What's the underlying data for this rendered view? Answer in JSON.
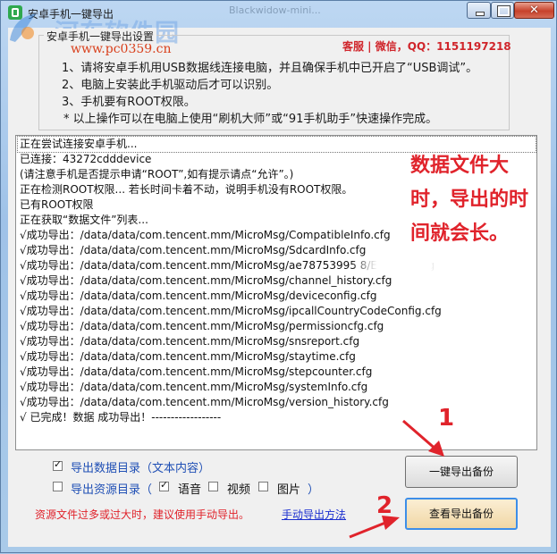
{
  "window": {
    "title": "安卓手机一键导出",
    "background_tab_text": "Blackwidow-mini...",
    "close_glyph": "✕"
  },
  "watermark": {
    "site": "河东软件园",
    "url": "www.pc0359.cn"
  },
  "settings_group": {
    "legend": "安卓手机一键导出设置",
    "contact": "客服 | 微信，QQ：1151197218",
    "instructions": [
      "1、请将安卓手机用USB数据线连接电脑，并且确保手机中已开启了“USB调试”。",
      "2、电脑上安装此手机驱动后才可以识别。",
      "3、手机要有ROOT权限。",
      "* 以上操作可以在电脑上使用“刷机大师”或“91手机助手”快速操作完成。"
    ]
  },
  "log": {
    "lines": [
      "正在尝试连接安卓手机...",
      "已连接：43272cdddevice",
      "(请注意手机是否提示申请“ROOT”,如有提示请点“允许”。)",
      "正在检测ROOT权限...      若长时间卡着不动，说明手机没有ROOT权限。",
      "已有ROOT权限",
      "正在获取“数据文件”列表...",
      "√成功导出：/data/data/com.tencent.mm/MicroMsg/CompatibleInfo.cfg",
      "√成功导出：/data/data/com.tencent.mm/MicroMsg/SdcardInfo.cfg",
      "√成功导出：/data/data/com.tencent.mm/MicroMsg/ae78753995                          8/EnMicroMsg",
      "√成功导出：/data/data/com.tencent.mm/MicroMsg/channel_history.cfg",
      "√成功导出：/data/data/com.tencent.mm/MicroMsg/deviceconfig.cfg",
      "√成功导出：/data/data/com.tencent.mm/MicroMsg/ipcallCountryCodeConfig.cfg",
      "√成功导出：/data/data/com.tencent.mm/MicroMsg/permissioncfg.cfg",
      "√成功导出：/data/data/com.tencent.mm/MicroMsg/snsreport.cfg",
      "√成功导出：/data/data/com.tencent.mm/MicroMsg/staytime.cfg",
      "√成功导出：/data/data/com.tencent.mm/MicroMsg/stepcounter.cfg",
      "√成功导出：/data/data/com.tencent.mm/MicroMsg/systemInfo.cfg",
      "√成功导出：/data/data/com.tencent.mm/MicroMsg/version_history.cfg",
      "√ 已完成！数据 成功导出！------------------"
    ]
  },
  "annotation": {
    "note_lines": [
      "数据文件大",
      "时，导出的时",
      "间就会长。"
    ],
    "num1": "1",
    "num2": "2",
    "color": "#e0232b"
  },
  "options": {
    "export_data_dir": {
      "label": "导出数据目录（文本内容）",
      "checked": true
    },
    "export_resource_dir": {
      "label": "导出资源目录（",
      "checked": false
    },
    "voice": {
      "label": "语音",
      "checked": true
    },
    "video": {
      "label": "视频",
      "checked": false
    },
    "picture": {
      "label": "图片",
      "checked": false
    },
    "close_paren": "）"
  },
  "warning": "资源文件过多或过大时，建议使用手动导出。",
  "manual_link": "手动导出方法",
  "buttons": {
    "export_backup": "一键导出备份",
    "view_backup": "查看导出备份"
  }
}
